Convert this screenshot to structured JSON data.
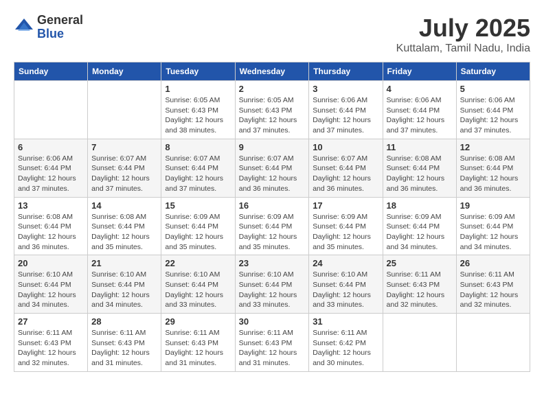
{
  "logo": {
    "general": "General",
    "blue": "Blue"
  },
  "title": "July 2025",
  "subtitle": "Kuttalam, Tamil Nadu, India",
  "weekdays": [
    "Sunday",
    "Monday",
    "Tuesday",
    "Wednesday",
    "Thursday",
    "Friday",
    "Saturday"
  ],
  "weeks": [
    [
      {
        "day": "",
        "sunrise": "",
        "sunset": "",
        "daylight": ""
      },
      {
        "day": "",
        "sunrise": "",
        "sunset": "",
        "daylight": ""
      },
      {
        "day": "1",
        "sunrise": "Sunrise: 6:05 AM",
        "sunset": "Sunset: 6:43 PM",
        "daylight": "Daylight: 12 hours and 38 minutes."
      },
      {
        "day": "2",
        "sunrise": "Sunrise: 6:05 AM",
        "sunset": "Sunset: 6:43 PM",
        "daylight": "Daylight: 12 hours and 37 minutes."
      },
      {
        "day": "3",
        "sunrise": "Sunrise: 6:06 AM",
        "sunset": "Sunset: 6:44 PM",
        "daylight": "Daylight: 12 hours and 37 minutes."
      },
      {
        "day": "4",
        "sunrise": "Sunrise: 6:06 AM",
        "sunset": "Sunset: 6:44 PM",
        "daylight": "Daylight: 12 hours and 37 minutes."
      },
      {
        "day": "5",
        "sunrise": "Sunrise: 6:06 AM",
        "sunset": "Sunset: 6:44 PM",
        "daylight": "Daylight: 12 hours and 37 minutes."
      }
    ],
    [
      {
        "day": "6",
        "sunrise": "Sunrise: 6:06 AM",
        "sunset": "Sunset: 6:44 PM",
        "daylight": "Daylight: 12 hours and 37 minutes."
      },
      {
        "day": "7",
        "sunrise": "Sunrise: 6:07 AM",
        "sunset": "Sunset: 6:44 PM",
        "daylight": "Daylight: 12 hours and 37 minutes."
      },
      {
        "day": "8",
        "sunrise": "Sunrise: 6:07 AM",
        "sunset": "Sunset: 6:44 PM",
        "daylight": "Daylight: 12 hours and 37 minutes."
      },
      {
        "day": "9",
        "sunrise": "Sunrise: 6:07 AM",
        "sunset": "Sunset: 6:44 PM",
        "daylight": "Daylight: 12 hours and 36 minutes."
      },
      {
        "day": "10",
        "sunrise": "Sunrise: 6:07 AM",
        "sunset": "Sunset: 6:44 PM",
        "daylight": "Daylight: 12 hours and 36 minutes."
      },
      {
        "day": "11",
        "sunrise": "Sunrise: 6:08 AM",
        "sunset": "Sunset: 6:44 PM",
        "daylight": "Daylight: 12 hours and 36 minutes."
      },
      {
        "day": "12",
        "sunrise": "Sunrise: 6:08 AM",
        "sunset": "Sunset: 6:44 PM",
        "daylight": "Daylight: 12 hours and 36 minutes."
      }
    ],
    [
      {
        "day": "13",
        "sunrise": "Sunrise: 6:08 AM",
        "sunset": "Sunset: 6:44 PM",
        "daylight": "Daylight: 12 hours and 36 minutes."
      },
      {
        "day": "14",
        "sunrise": "Sunrise: 6:08 AM",
        "sunset": "Sunset: 6:44 PM",
        "daylight": "Daylight: 12 hours and 35 minutes."
      },
      {
        "day": "15",
        "sunrise": "Sunrise: 6:09 AM",
        "sunset": "Sunset: 6:44 PM",
        "daylight": "Daylight: 12 hours and 35 minutes."
      },
      {
        "day": "16",
        "sunrise": "Sunrise: 6:09 AM",
        "sunset": "Sunset: 6:44 PM",
        "daylight": "Daylight: 12 hours and 35 minutes."
      },
      {
        "day": "17",
        "sunrise": "Sunrise: 6:09 AM",
        "sunset": "Sunset: 6:44 PM",
        "daylight": "Daylight: 12 hours and 35 minutes."
      },
      {
        "day": "18",
        "sunrise": "Sunrise: 6:09 AM",
        "sunset": "Sunset: 6:44 PM",
        "daylight": "Daylight: 12 hours and 34 minutes."
      },
      {
        "day": "19",
        "sunrise": "Sunrise: 6:09 AM",
        "sunset": "Sunset: 6:44 PM",
        "daylight": "Daylight: 12 hours and 34 minutes."
      }
    ],
    [
      {
        "day": "20",
        "sunrise": "Sunrise: 6:10 AM",
        "sunset": "Sunset: 6:44 PM",
        "daylight": "Daylight: 12 hours and 34 minutes."
      },
      {
        "day": "21",
        "sunrise": "Sunrise: 6:10 AM",
        "sunset": "Sunset: 6:44 PM",
        "daylight": "Daylight: 12 hours and 34 minutes."
      },
      {
        "day": "22",
        "sunrise": "Sunrise: 6:10 AM",
        "sunset": "Sunset: 6:44 PM",
        "daylight": "Daylight: 12 hours and 33 minutes."
      },
      {
        "day": "23",
        "sunrise": "Sunrise: 6:10 AM",
        "sunset": "Sunset: 6:44 PM",
        "daylight": "Daylight: 12 hours and 33 minutes."
      },
      {
        "day": "24",
        "sunrise": "Sunrise: 6:10 AM",
        "sunset": "Sunset: 6:44 PM",
        "daylight": "Daylight: 12 hours and 33 minutes."
      },
      {
        "day": "25",
        "sunrise": "Sunrise: 6:11 AM",
        "sunset": "Sunset: 6:43 PM",
        "daylight": "Daylight: 12 hours and 32 minutes."
      },
      {
        "day": "26",
        "sunrise": "Sunrise: 6:11 AM",
        "sunset": "Sunset: 6:43 PM",
        "daylight": "Daylight: 12 hours and 32 minutes."
      }
    ],
    [
      {
        "day": "27",
        "sunrise": "Sunrise: 6:11 AM",
        "sunset": "Sunset: 6:43 PM",
        "daylight": "Daylight: 12 hours and 32 minutes."
      },
      {
        "day": "28",
        "sunrise": "Sunrise: 6:11 AM",
        "sunset": "Sunset: 6:43 PM",
        "daylight": "Daylight: 12 hours and 31 minutes."
      },
      {
        "day": "29",
        "sunrise": "Sunrise: 6:11 AM",
        "sunset": "Sunset: 6:43 PM",
        "daylight": "Daylight: 12 hours and 31 minutes."
      },
      {
        "day": "30",
        "sunrise": "Sunrise: 6:11 AM",
        "sunset": "Sunset: 6:43 PM",
        "daylight": "Daylight: 12 hours and 31 minutes."
      },
      {
        "day": "31",
        "sunrise": "Sunrise: 6:11 AM",
        "sunset": "Sunset: 6:42 PM",
        "daylight": "Daylight: 12 hours and 30 minutes."
      },
      {
        "day": "",
        "sunrise": "",
        "sunset": "",
        "daylight": ""
      },
      {
        "day": "",
        "sunrise": "",
        "sunset": "",
        "daylight": ""
      }
    ]
  ]
}
